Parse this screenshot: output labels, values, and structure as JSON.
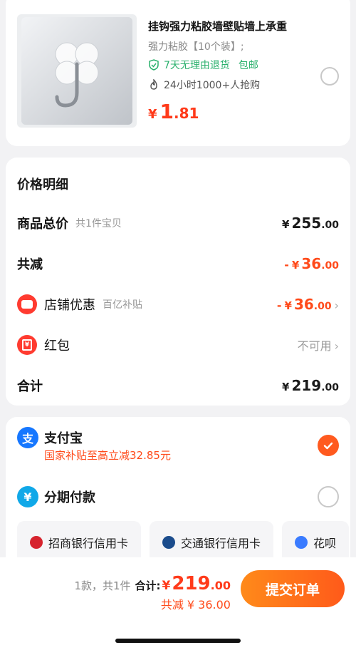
{
  "product": {
    "title": "挂钩强力粘胶墙壁贴墙上承重",
    "spec": "强力粘胶【10个装】;",
    "return_policy": "7天无理由退货",
    "shipping": "包邮",
    "hot": "24小时1000+人抢购",
    "price_symbol": "¥",
    "price_int": "1",
    "price_dec": ".81"
  },
  "price_detail": {
    "title": "价格明细",
    "total_label": "商品总价",
    "total_sub": "共1件宝贝",
    "total_int": "255",
    "total_dec": ".00",
    "reduce_label": "共减",
    "reduce_int": "36",
    "reduce_dec": ".00",
    "shop_label": "店铺优惠",
    "shop_sub": "百亿补贴",
    "shop_int": "36",
    "shop_dec": ".00",
    "redpack_label": "红包",
    "redpack_value": "不可用",
    "sum_label": "合计",
    "sum_int": "219",
    "sum_dec": ".00",
    "currency": "¥",
    "minus": "-",
    "chevron": "›",
    "redpack_glyph": "¥"
  },
  "payment": {
    "alipay_name": "支付宝",
    "alipay_glyph": "支",
    "alipay_promo": "国家补贴至高立减32.85元",
    "installment_name": "分期付款",
    "installment_glyph": "¥",
    "banks": [
      "招商银行信用卡",
      "交通银行信用卡",
      "花呗"
    ]
  },
  "bottom": {
    "count": "1款，共1件",
    "total_label": "合计:",
    "currency": "¥",
    "total_int": "219",
    "total_dec": ".00",
    "save": "共减 ¥ 36.00",
    "submit": "提交订单"
  },
  "colors": {
    "accent": "#ff5a1f",
    "price_red": "#ff3a1a",
    "green": "#2ab06c",
    "alipay_blue": "#1677ff"
  }
}
